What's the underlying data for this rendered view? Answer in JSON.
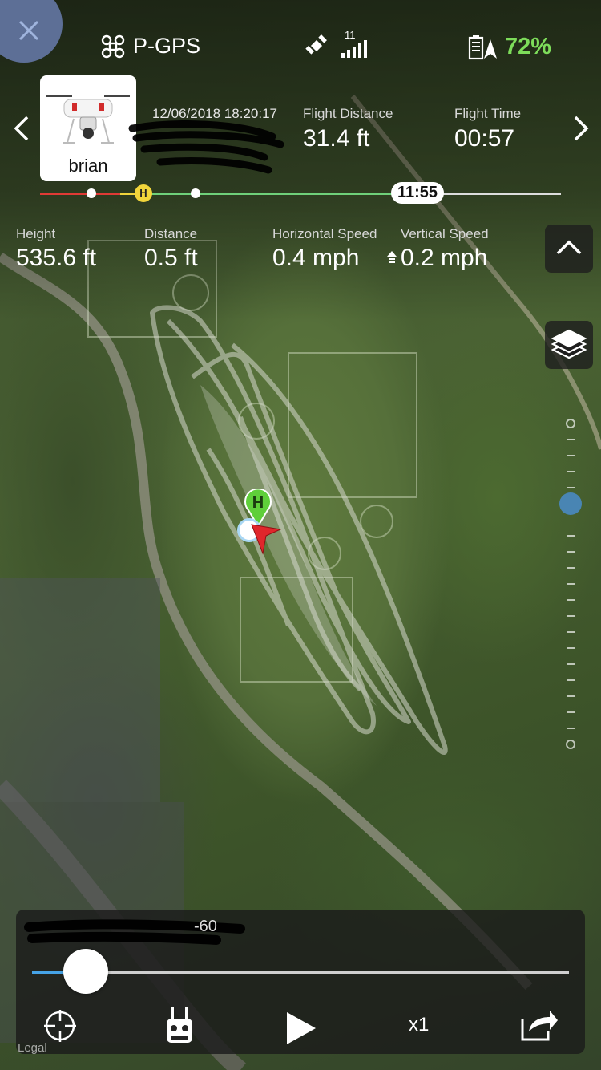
{
  "status": {
    "mode": "P-GPS",
    "satellites": "11",
    "battery": "72%"
  },
  "record": {
    "user": "brian",
    "datetime": "12/06/2018 18:20:17"
  },
  "header_stats": [
    {
      "label": "Flight Distance",
      "value": "31.4 ft"
    },
    {
      "label": "Flight Time",
      "value": "00:57"
    }
  ],
  "telemetry": [
    {
      "label": "Height",
      "value": "535.6 ft"
    },
    {
      "label": "Distance",
      "value": "0.5 ft"
    },
    {
      "label": "Horizontal Speed",
      "value": "0.4 mph"
    },
    {
      "label": "Vertical Speed",
      "value": "0.2 mph"
    }
  ],
  "timeline": {
    "marker_h": "H",
    "time": "11:55"
  },
  "map": {
    "home_marker": "H"
  },
  "playback": {
    "caption_fragment": "-60",
    "progress": 0.1,
    "speed": "x1"
  },
  "footer": {
    "legal": "Legal"
  },
  "icons": {
    "close": "close-icon",
    "drone": "drone-icon",
    "satellite": "satellite-icon",
    "battery": "battery-icon",
    "prev": "chevron-left-icon",
    "next": "chevron-right-icon",
    "collapse": "chevron-up-icon",
    "layers": "layers-icon",
    "locate": "crosshair-icon",
    "controller": "remote-controller-icon",
    "play": "play-icon",
    "share": "share-icon"
  },
  "colors": {
    "battery_green": "#7ddc5a",
    "progress_blue": "#46a3e6",
    "home_green": "#5fcf3a",
    "aircraft_red": "#e0262b"
  }
}
